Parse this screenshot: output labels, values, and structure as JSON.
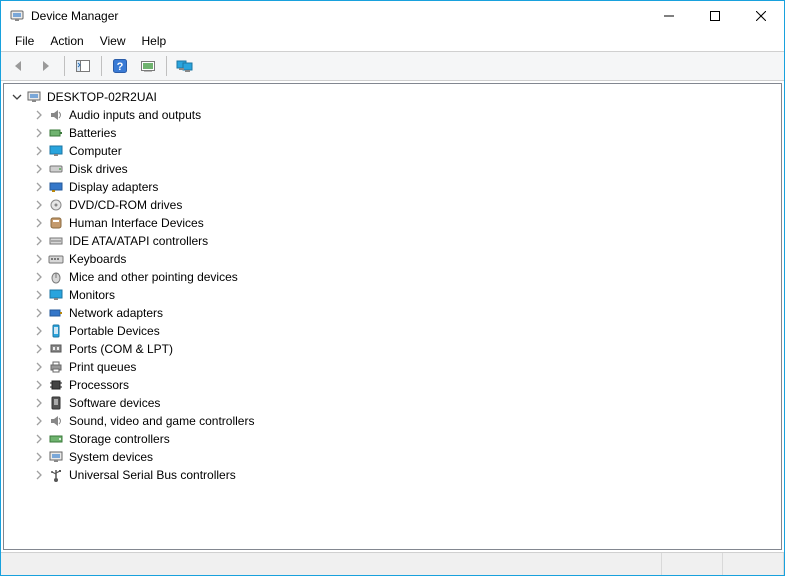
{
  "window": {
    "title": "Device Manager"
  },
  "menu": {
    "file": "File",
    "action": "Action",
    "view": "View",
    "help": "Help"
  },
  "toolbar_icons": {
    "back": "back-icon",
    "forward": "forward-icon",
    "show_hide": "show-hide-tree-icon",
    "help": "help-icon",
    "scan": "scan-hardware-icon",
    "monitors": "monitors-icon"
  },
  "tree": {
    "root": {
      "label": "DESKTOP-02R2UAI",
      "expanded": true,
      "icon": "computer-icon"
    },
    "categories": [
      {
        "label": "Audio inputs and outputs",
        "icon": "audio-icon"
      },
      {
        "label": "Batteries",
        "icon": "battery-icon"
      },
      {
        "label": "Computer",
        "icon": "computer-monitor-icon"
      },
      {
        "label": "Disk drives",
        "icon": "disk-drive-icon"
      },
      {
        "label": "Display adapters",
        "icon": "display-adapter-icon"
      },
      {
        "label": "DVD/CD-ROM drives",
        "icon": "optical-drive-icon"
      },
      {
        "label": "Human Interface Devices",
        "icon": "hid-icon"
      },
      {
        "label": "IDE ATA/ATAPI controllers",
        "icon": "ide-controller-icon"
      },
      {
        "label": "Keyboards",
        "icon": "keyboard-icon"
      },
      {
        "label": "Mice and other pointing devices",
        "icon": "mouse-icon"
      },
      {
        "label": "Monitors",
        "icon": "monitor-icon"
      },
      {
        "label": "Network adapters",
        "icon": "network-adapter-icon"
      },
      {
        "label": "Portable Devices",
        "icon": "portable-device-icon"
      },
      {
        "label": "Ports (COM & LPT)",
        "icon": "port-icon"
      },
      {
        "label": "Print queues",
        "icon": "printer-icon"
      },
      {
        "label": "Processors",
        "icon": "processor-icon"
      },
      {
        "label": "Software devices",
        "icon": "software-device-icon"
      },
      {
        "label": "Sound, video and game controllers",
        "icon": "sound-controller-icon"
      },
      {
        "label": "Storage controllers",
        "icon": "storage-controller-icon"
      },
      {
        "label": "System devices",
        "icon": "system-device-icon"
      },
      {
        "label": "Universal Serial Bus controllers",
        "icon": "usb-controller-icon"
      }
    ]
  }
}
